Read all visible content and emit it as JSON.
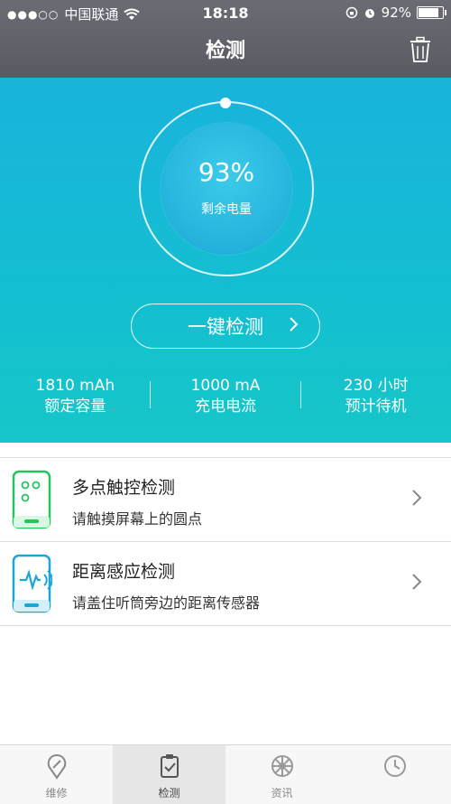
{
  "status_bar": {
    "carrier": "中国联通",
    "time": "18:18",
    "battery_text": "92%",
    "battery_level": 0.92
  },
  "header": {
    "title": "检测",
    "right_icon": "trash-icon"
  },
  "battery_panel": {
    "percent": "93%",
    "label": "剩余电量",
    "check_button": "一键检测",
    "stats": [
      {
        "value": "1810 mAh",
        "label": "额定容量"
      },
      {
        "value": "1000 mA",
        "label": "充电电流"
      },
      {
        "value": "230 小时",
        "label": "预计待机"
      }
    ]
  },
  "list": [
    {
      "title": "多点触控检测",
      "subtitle": "请触摸屏幕上的圆点",
      "icon": "phone-touch-icon",
      "icon_color": "#22c55e"
    },
    {
      "title": "距离感应检测",
      "subtitle": "请盖住听筒旁边的距离传感器",
      "icon": "phone-proximity-icon",
      "icon_color": "#1ba6d8"
    }
  ],
  "tabbar": {
    "tabs": [
      {
        "label": "维修",
        "icon": "wrench-icon"
      },
      {
        "label": "检测",
        "icon": "clipboard-check-icon"
      },
      {
        "label": "资讯",
        "icon": "news-icon"
      },
      {
        "label": "",
        "icon": "clock-icon"
      }
    ],
    "active_index": 1
  },
  "colors": {
    "header_bg": "#5f5f67",
    "hero_bg": "#17bcd4",
    "accent_green": "#22c55e",
    "accent_blue": "#1ba6d8"
  }
}
